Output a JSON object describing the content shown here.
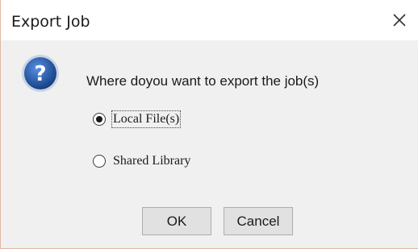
{
  "window": {
    "title": "Export Job",
    "close_icon": "close-icon"
  },
  "message": {
    "icon": "question-icon",
    "text": "Where doyou want to export the job(s)"
  },
  "options": [
    {
      "label": "Local File(s)",
      "selected": true
    },
    {
      "label": "Shared Library",
      "selected": false
    }
  ],
  "buttons": {
    "ok_label": "OK",
    "cancel_label": "Cancel"
  },
  "colors": {
    "icon_blue": "#2b5ca8",
    "dialog_bg": "#f0f0f0",
    "button_bg": "#e1e1e1"
  }
}
